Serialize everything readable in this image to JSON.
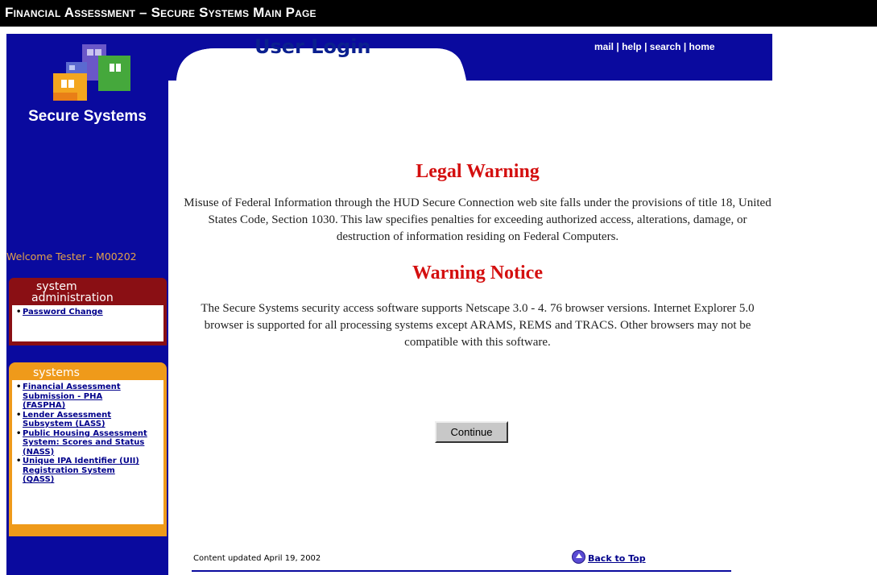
{
  "window": {
    "title": "Financial Assessment – Secure Systems Main Page"
  },
  "sidebar": {
    "logo_text": "Secure Systems",
    "welcome": "Welcome Tester - M00202",
    "admin_panel": {
      "title_line1": "system",
      "title_line2": "administration",
      "links": [
        "Password Change"
      ]
    },
    "systems_panel": {
      "title": "systems",
      "links": [
        [
          "Financial Assessment",
          "Submission - PHA",
          "(FASPHA)"
        ],
        [
          "Lender Assessment",
          "Subsystem (LASS)"
        ],
        [
          "Public Housing Assessment",
          "System: Scores and Status",
          "(NASS)"
        ],
        [
          "Unique IPA Identifier (UII)",
          "Registration System",
          "(QASS)"
        ]
      ]
    }
  },
  "header": {
    "title": "User Login",
    "links": {
      "mail": "mail",
      "help": "help",
      "search": "search",
      "home": "home",
      "separator": "|"
    }
  },
  "main": {
    "legal_heading": "Legal Warning",
    "legal_text": "Misuse of Federal Information through the HUD Secure Connection web site falls under the provisions of title 18, United States Code, Section 1030. This law specifies penalties for exceeding authorized access, alterations, damage, or destruction of information residing on Federal Computers.",
    "notice_heading": "Warning Notice",
    "notice_text": "The Secure Systems security access software supports Netscape 3.0 - 4. 76 browser versions. Internet Explorer 5.0 browser is supported for all processing systems except ARAMS, REMS and TRACS. Other browsers may not be compatible with this software.",
    "continue_label": "Continue"
  },
  "footer": {
    "updated": "Content updated April 19, 2002",
    "back_to_top": "Back to Top"
  },
  "colors": {
    "sidebar_blue": "#0a0a9e",
    "admin_red": "#8a0f14",
    "systems_orange": "#ef9a1a",
    "heading_red": "#d40f0f",
    "welcome_orange": "#e2a24a"
  }
}
